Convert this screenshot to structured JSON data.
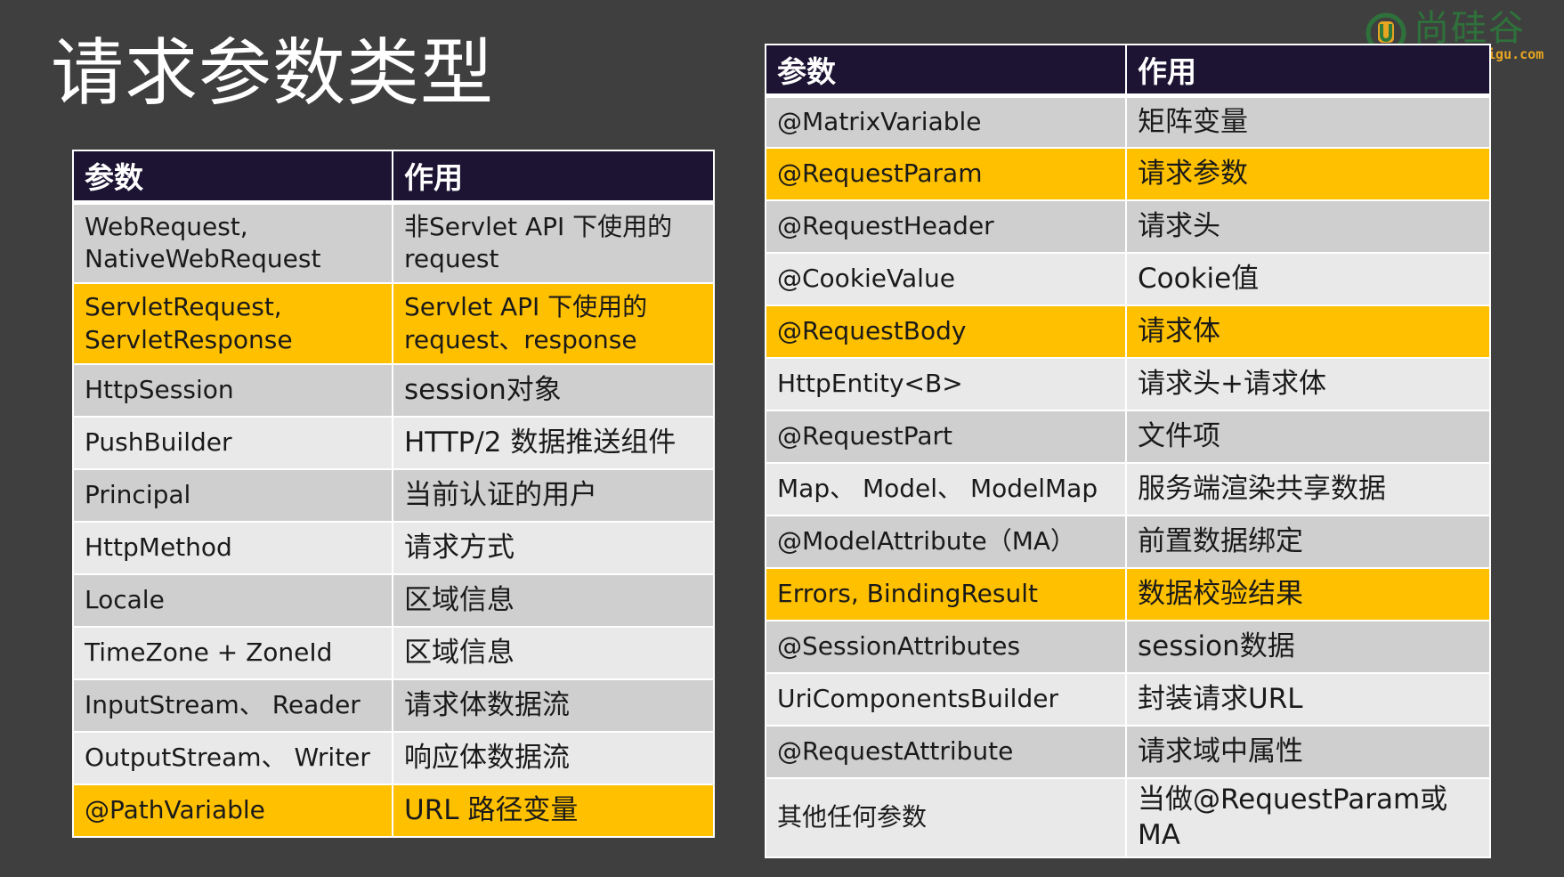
{
  "title": "请求参数类型",
  "logo": {
    "text": "尚硅谷",
    "sub": "jigu.com",
    "colors": {
      "green": "#2d7a3b",
      "orange": "#e8a521"
    }
  },
  "colors": {
    "background": "#3f3f3f",
    "header": "#1d1433",
    "row_dark": "#cfcfcf",
    "row_light": "#e9e9e9",
    "highlight": "#ffc000"
  },
  "left_table": {
    "headers": [
      "参数",
      "作用"
    ],
    "rows": [
      {
        "param_lines": [
          "WebRequest,",
          "NativeWebRequest"
        ],
        "purpose_lines": [
          "非Servlet API 下使用的",
          "request"
        ],
        "highlight": false
      },
      {
        "param_lines": [
          "ServletRequest,",
          "ServletResponse"
        ],
        "purpose_lines": [
          "Servlet API 下使用的",
          "request、response"
        ],
        "highlight": true
      },
      {
        "param": "HttpSession",
        "purpose": "session对象",
        "highlight": false
      },
      {
        "param": "PushBuilder",
        "purpose": "HTTP/2 数据推送组件",
        "highlight": false
      },
      {
        "param": "Principal",
        "purpose": "当前认证的用户",
        "highlight": false
      },
      {
        "param": "HttpMethod",
        "purpose": "请求方式",
        "highlight": false
      },
      {
        "param": "Locale",
        "purpose": "区域信息",
        "highlight": false
      },
      {
        "param": "TimeZone + ZoneId",
        "purpose": "区域信息",
        "highlight": false
      },
      {
        "param": "InputStream、 Reader",
        "purpose": "请求体数据流",
        "highlight": false
      },
      {
        "param": "OutputStream、 Writer",
        "purpose": "响应体数据流",
        "highlight": false
      },
      {
        "param": "@PathVariable",
        "purpose": "URL 路径变量",
        "highlight": true
      }
    ]
  },
  "right_table": {
    "headers": [
      "参数",
      "作用"
    ],
    "rows": [
      {
        "param": "@MatrixVariable",
        "purpose": "矩阵变量",
        "highlight": false
      },
      {
        "param": "@RequestParam",
        "purpose": "请求参数",
        "highlight": true
      },
      {
        "param": "@RequestHeader",
        "purpose": "请求头",
        "highlight": false
      },
      {
        "param": "@CookieValue",
        "purpose": "Cookie值",
        "highlight": false
      },
      {
        "param": "@RequestBody",
        "purpose": "请求体",
        "highlight": true
      },
      {
        "param": "HttpEntity<B>",
        "purpose": "请求头+请求体",
        "highlight": false
      },
      {
        "param": "@RequestPart",
        "purpose": "文件项",
        "highlight": false
      },
      {
        "param": "Map、 Model、 ModelMap",
        "purpose": "服务端渲染共享数据",
        "highlight": false
      },
      {
        "param": "@ModelAttribute（MA）",
        "purpose": "前置数据绑定",
        "highlight": false
      },
      {
        "param": "Errors, BindingResult",
        "purpose": "数据校验结果",
        "highlight": true
      },
      {
        "param": "@SessionAttributes",
        "purpose": "session数据",
        "highlight": false
      },
      {
        "param": "UriComponentsBuilder",
        "purpose": "封装请求URL",
        "highlight": false
      },
      {
        "param": "@RequestAttribute",
        "purpose": "请求域中属性",
        "highlight": false
      },
      {
        "param": "其他任何参数",
        "purpose": "当做@RequestParam或MA",
        "highlight": false
      }
    ]
  }
}
